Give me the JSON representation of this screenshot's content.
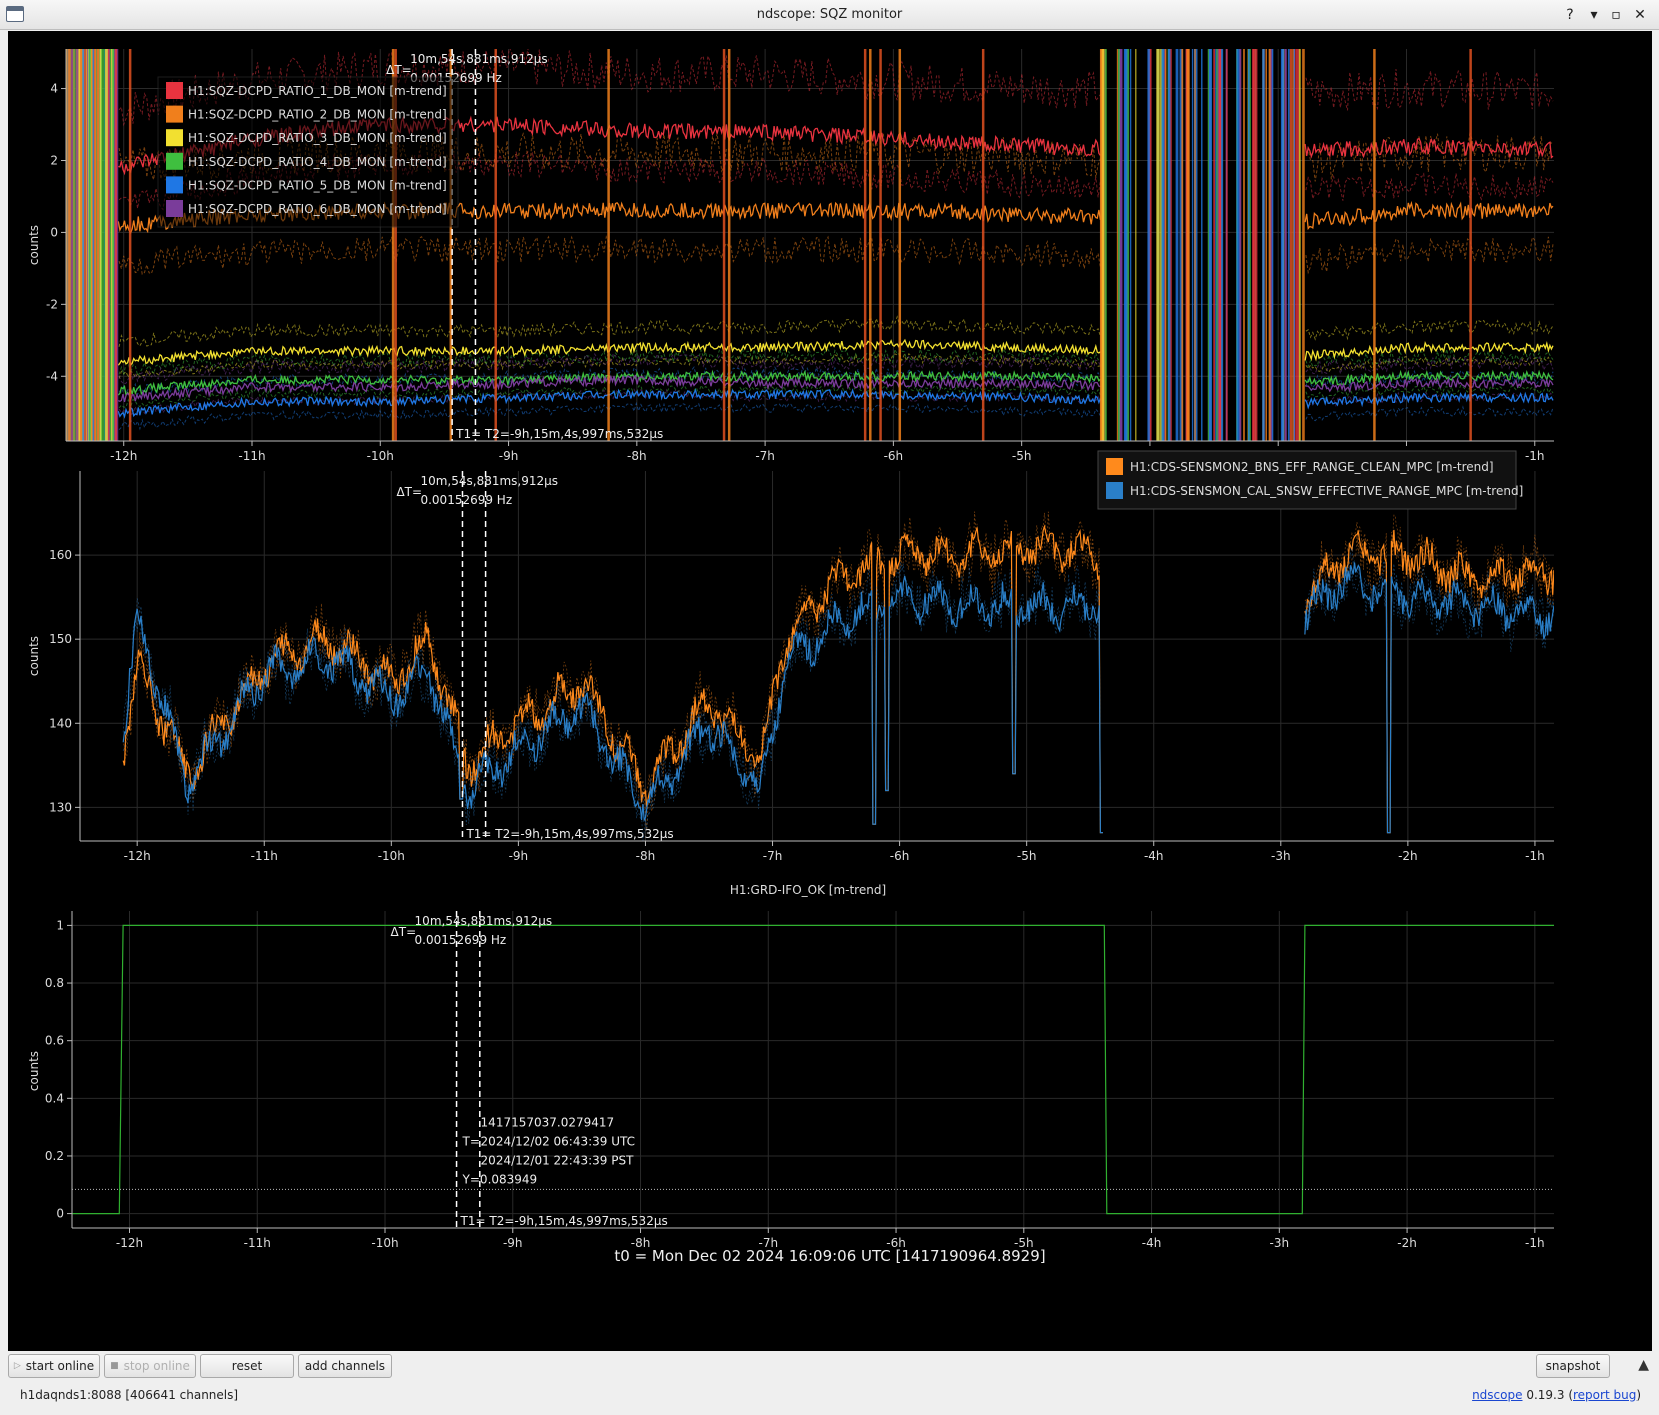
{
  "window": {
    "title": "ndscope: SQZ monitor"
  },
  "x_axis": {
    "ticks": [
      "-12h",
      "-11h",
      "-10h",
      "-9h",
      "-8h",
      "-7h",
      "-6h",
      "-5h",
      "-4h",
      "-3h",
      "-2h",
      "-1h"
    ],
    "range_hours": [
      -12.45,
      -0.85
    ]
  },
  "cursors": {
    "delta_label": "ΔT=",
    "delta_time": "10m,54s,881ms,912µs",
    "delta_freq": "0.00152699 Hz",
    "t_label": "T1= T2=-9h,15m,4s,997ms,532µs",
    "t1_hours": -9.44,
    "t2_hours": -9.258
  },
  "colors": {
    "red": "#e8333f",
    "orange": "#f07f1c",
    "yellow": "#f2e030",
    "green": "#3fbf3f",
    "blue": "#1f77e4",
    "purple": "#7a3c9a",
    "c2_orange": "#ff8a1c",
    "c2_blue": "#2a7fc8",
    "c3_green": "#30b030"
  },
  "plot1": {
    "ylabel": "counts",
    "yticks": [
      "4",
      "2",
      "0",
      "-2",
      "-4"
    ],
    "yrange": [
      -5.8,
      5.1
    ],
    "legend": [
      {
        "label": "H1:SQZ-DCPD_RATIO_1_DB_MON [m-trend]",
        "color": "#e8333f"
      },
      {
        "label": "H1:SQZ-DCPD_RATIO_2_DB_MON [m-trend]",
        "color": "#f07f1c"
      },
      {
        "label": "H1:SQZ-DCPD_RATIO_3_DB_MON [m-trend]",
        "color": "#f2e030"
      },
      {
        "label": "H1:SQZ-DCPD_RATIO_4_DB_MON [m-trend]",
        "color": "#3fbf3f"
      },
      {
        "label": "H1:SQZ-DCPD_RATIO_5_DB_MON [m-trend]",
        "color": "#1f77e4"
      },
      {
        "label": "H1:SQZ-DCPD_RATIO_6_DB_MON [m-trend]",
        "color": "#7a3c9a"
      }
    ]
  },
  "plot2": {
    "ylabel": "counts",
    "yticks": [
      "160",
      "150",
      "140",
      "130"
    ],
    "yrange": [
      126,
      170
    ],
    "legend": [
      {
        "label": "H1:CDS-SENSMON2_BNS_EFF_RANGE_CLEAN_MPC [m-trend]",
        "color": "#ff8a1c"
      },
      {
        "label": "H1:CDS-SENSMON_CAL_SNSW_EFFECTIVE_RANGE_MPC [m-trend]",
        "color": "#2a7fc8"
      }
    ]
  },
  "plot3": {
    "title": "H1:GRD-IFO_OK [m-trend]",
    "ylabel": "counts",
    "yticks": [
      "1",
      "0.8",
      "0.6",
      "0.4",
      "0.2",
      "0"
    ],
    "yrange": [
      -0.05,
      1.05
    ],
    "crosshair": {
      "gps": "1417157037.0279417",
      "t_label": "T=",
      "utc": "2024/12/02 06:43:39 UTC",
      "pst": "2024/12/01 22:43:39 PST",
      "y": "Y=0.083949",
      "y_value": 0.083949
    }
  },
  "chart_data": [
    {
      "type": "line",
      "title": "",
      "ylabel": "counts",
      "x_unit": "hours before t0",
      "ylim": [
        -5.8,
        5.1
      ],
      "series": [
        {
          "name": "H1:SQZ-DCPD_RATIO_1_DB_MON [m-trend]",
          "points": [
            [
              -12,
              1.8
            ],
            [
              -11,
              2.6
            ],
            [
              -10,
              3
            ],
            [
              -9,
              3
            ],
            [
              -8,
              2.8
            ],
            [
              -7,
              2.8
            ],
            [
              -6,
              2.6
            ],
            [
              -5,
              2.4
            ],
            [
              -3,
              2.2
            ],
            [
              -2,
              2.4
            ],
            [
              -1,
              2.3
            ]
          ]
        },
        {
          "name": "H1:SQZ-DCPD_RATIO_2_DB_MON [m-trend]",
          "points": [
            [
              -12,
              0.2
            ],
            [
              -11,
              0.5
            ],
            [
              -10,
              0.6
            ],
            [
              -9,
              0.6
            ],
            [
              -8,
              0.6
            ],
            [
              -7,
              0.6
            ],
            [
              -6,
              0.6
            ],
            [
              -5,
              0.5
            ],
            [
              -3,
              0.2
            ],
            [
              -2,
              0.6
            ],
            [
              -1,
              0.6
            ]
          ]
        },
        {
          "name": "H1:SQZ-DCPD_RATIO_3_DB_MON [m-trend]",
          "points": [
            [
              -12,
              -3.6
            ],
            [
              -11,
              -3.3
            ],
            [
              -10,
              -3.3
            ],
            [
              -9,
              -3.3
            ],
            [
              -8,
              -3.2
            ],
            [
              -7,
              -3.2
            ],
            [
              -6,
              -3.1
            ],
            [
              -5,
              -3.2
            ],
            [
              -3,
              -3.5
            ],
            [
              -2,
              -3.2
            ],
            [
              -1,
              -3.2
            ]
          ]
        },
        {
          "name": "H1:SQZ-DCPD_RATIO_4_DB_MON [m-trend]",
          "points": [
            [
              -12,
              -4.4
            ],
            [
              -11,
              -4.1
            ],
            [
              -10,
              -4.1
            ],
            [
              -9,
              -4.1
            ],
            [
              -8,
              -4
            ],
            [
              -7,
              -4
            ],
            [
              -6,
              -4
            ],
            [
              -5,
              -4
            ],
            [
              -3,
              -4.2
            ],
            [
              -2,
              -4
            ],
            [
              -1,
              -4
            ]
          ]
        },
        {
          "name": "H1:SQZ-DCPD_RATIO_5_DB_MON [m-trend]",
          "points": [
            [
              -12,
              -5
            ],
            [
              -11,
              -4.7
            ],
            [
              -10,
              -4.7
            ],
            [
              -9,
              -4.6
            ],
            [
              -8,
              -4.5
            ],
            [
              -7,
              -4.5
            ],
            [
              -6,
              -4.5
            ],
            [
              -5,
              -4.6
            ],
            [
              -3,
              -4.8
            ],
            [
              -2,
              -4.6
            ],
            [
              -1,
              -4.6
            ]
          ]
        },
        {
          "name": "H1:SQZ-DCPD_RATIO_6_DB_MON [m-trend]",
          "points": [
            [
              -12,
              -4.6
            ],
            [
              -11,
              -4.3
            ],
            [
              -10,
              -4.3
            ],
            [
              -9,
              -4.2
            ],
            [
              -8,
              -4.1
            ],
            [
              -7,
              -4.2
            ],
            [
              -6,
              -4.2
            ],
            [
              -5,
              -4.2
            ],
            [
              -3,
              -4.4
            ],
            [
              -2,
              -4.2
            ],
            [
              -1,
              -4.2
            ]
          ]
        }
      ]
    },
    {
      "type": "line",
      "title": "",
      "ylabel": "counts",
      "x_unit": "hours before t0",
      "ylim": [
        126,
        170
      ],
      "series": [
        {
          "name": "H1:CDS-SENSMON2_BNS_EFF_RANGE_CLEAN_MPC [m-trend]",
          "points": [
            [
              -12.1,
              138
            ],
            [
              -12,
              147
            ],
            [
              -11.6,
              134
            ],
            [
              -11,
              147
            ],
            [
              -10.5,
              150
            ],
            [
              -10,
              145
            ],
            [
              -9.7,
              150
            ],
            [
              -9.4,
              135
            ],
            [
              -9,
              140
            ],
            [
              -8.5,
              145
            ],
            [
              -8,
              132
            ],
            [
              -7.5,
              143
            ],
            [
              -7.1,
              135
            ],
            [
              -6.9,
              150
            ],
            [
              -6.5,
              157
            ],
            [
              -6,
              160
            ],
            [
              -5.5,
              160
            ],
            [
              -5,
              161
            ],
            [
              -4.4,
              160
            ],
            [
              -2.8,
              155
            ],
            [
              -2.5,
              160
            ],
            [
              -2,
              160
            ],
            [
              -1.5,
              157
            ],
            [
              -1,
              158
            ]
          ]
        },
        {
          "name": "H1:CDS-SENSMON_CAL_SNSW_EFFECTIVE_RANGE_MPC [m-trend]",
          "points": [
            [
              -12.1,
              140
            ],
            [
              -12,
              152
            ],
            [
              -11.6,
              133
            ],
            [
              -11,
              146
            ],
            [
              -10.5,
              148
            ],
            [
              -10,
              143
            ],
            [
              -9.7,
              146
            ],
            [
              -9.4,
              132
            ],
            [
              -9,
              137
            ],
            [
              -8.5,
              142
            ],
            [
              -8,
              130
            ],
            [
              -7.5,
              140
            ],
            [
              -7.1,
              132
            ],
            [
              -6.9,
              147
            ],
            [
              -6.5,
              152
            ],
            [
              -6,
              155
            ],
            [
              -5.5,
              154
            ],
            [
              -5,
              154
            ],
            [
              -4.4,
              154
            ],
            [
              -2.8,
              153
            ],
            [
              -2.5,
              157
            ],
            [
              -2,
              155
            ],
            [
              -1.5,
              154
            ],
            [
              -1,
              153
            ]
          ]
        }
      ]
    },
    {
      "type": "line",
      "title": "H1:GRD-IFO_OK [m-trend]",
      "ylabel": "counts",
      "x_unit": "hours before t0",
      "ylim": [
        -0.05,
        1.05
      ],
      "series": [
        {
          "name": "H1:GRD-IFO_OK [m-trend]",
          "points": [
            [
              -12.45,
              0
            ],
            [
              -12.08,
              0
            ],
            [
              -12.05,
              1
            ],
            [
              -4.37,
              1
            ],
            [
              -4.35,
              0
            ],
            [
              -2.82,
              0
            ],
            [
              -2.8,
              1
            ],
            [
              -0.85,
              1
            ]
          ]
        }
      ]
    }
  ],
  "footer": {
    "t0": "t0 = Mon Dec 02 2024 16:09:06 UTC [1417190964.8929]"
  },
  "toolbar": {
    "start_online": "start online",
    "stop_online": "stop online",
    "reset": "reset",
    "add_channels": "add channels",
    "snapshot": "snapshot"
  },
  "status": {
    "server": "h1daqnds1:8088  [406641 channels]",
    "app_name": "ndscope",
    "version": "0.19.3",
    "report_bug": "report bug"
  }
}
